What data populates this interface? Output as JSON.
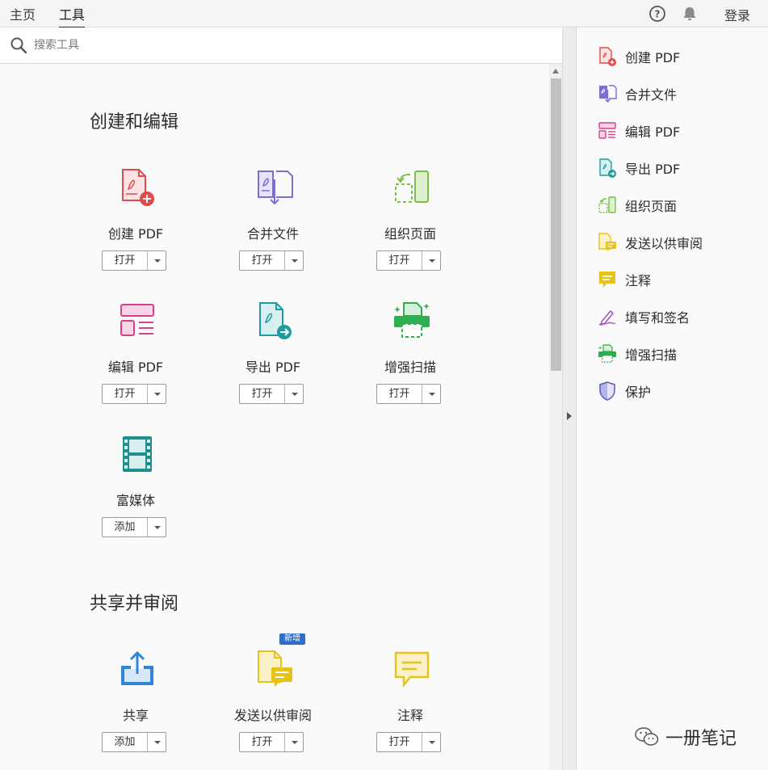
{
  "top_bar": {
    "tabs": [
      "主页",
      "工具"
    ],
    "active_tab": "工具",
    "login_label": "登录"
  },
  "search": {
    "placeholder": "搜索工具"
  },
  "sections": [
    {
      "title": "创建和编辑",
      "tools": [
        {
          "label": "创建 PDF",
          "button": "打开",
          "icon": "create-pdf-icon",
          "color": "#e04a4a"
        },
        {
          "label": "合并文件",
          "button": "打开",
          "icon": "combine-files-icon",
          "color": "#7b6fd6"
        },
        {
          "label": "组织页面",
          "button": "打开",
          "icon": "organize-pages-icon",
          "color": "#7ac04a"
        },
        {
          "label": "编辑 PDF",
          "button": "打开",
          "icon": "edit-pdf-icon",
          "color": "#d6408a"
        },
        {
          "label": "导出 PDF",
          "button": "打开",
          "icon": "export-pdf-icon",
          "color": "#1e9aa0"
        },
        {
          "label": "增强扫描",
          "button": "打开",
          "icon": "enhance-scan-icon",
          "color": "#2fae4f"
        },
        {
          "label": "富媒体",
          "button": "添加",
          "icon": "rich-media-icon",
          "color": "#1e8f8c"
        }
      ]
    },
    {
      "title": "共享并审阅",
      "tools": [
        {
          "label": "共享",
          "button": "添加",
          "icon": "share-icon",
          "color": "#2f86d6"
        },
        {
          "label": "发送以供审阅",
          "button": "打开",
          "icon": "send-for-review-icon",
          "color": "#e6c31a",
          "badge": "新增"
        },
        {
          "label": "注释",
          "button": "打开",
          "icon": "comment-icon",
          "color": "#e6c31a"
        }
      ]
    }
  ],
  "right_panel": [
    {
      "label": "创建 PDF",
      "icon": "create-pdf-icon",
      "color": "#e04a4a"
    },
    {
      "label": "合并文件",
      "icon": "combine-files-icon",
      "color": "#7b6fd6"
    },
    {
      "label": "编辑 PDF",
      "icon": "edit-pdf-icon",
      "color": "#d6408a"
    },
    {
      "label": "导出 PDF",
      "icon": "export-pdf-icon",
      "color": "#1e9aa0"
    },
    {
      "label": "组织页面",
      "icon": "organize-pages-icon",
      "color": "#7ac04a"
    },
    {
      "label": "发送以供审阅",
      "icon": "send-for-review-icon",
      "color": "#e6c31a"
    },
    {
      "label": "注释",
      "icon": "comment-icon",
      "color": "#e6c31a"
    },
    {
      "label": "填写和签名",
      "icon": "fill-sign-icon",
      "color": "#9b59c6"
    },
    {
      "label": "增强扫描",
      "icon": "enhance-scan-icon",
      "color": "#2fae4f"
    },
    {
      "label": "保护",
      "icon": "protect-icon",
      "color": "#5b5fc7"
    }
  ],
  "watermark": {
    "label": "一册笔记",
    "icon": "wechat-icon"
  }
}
